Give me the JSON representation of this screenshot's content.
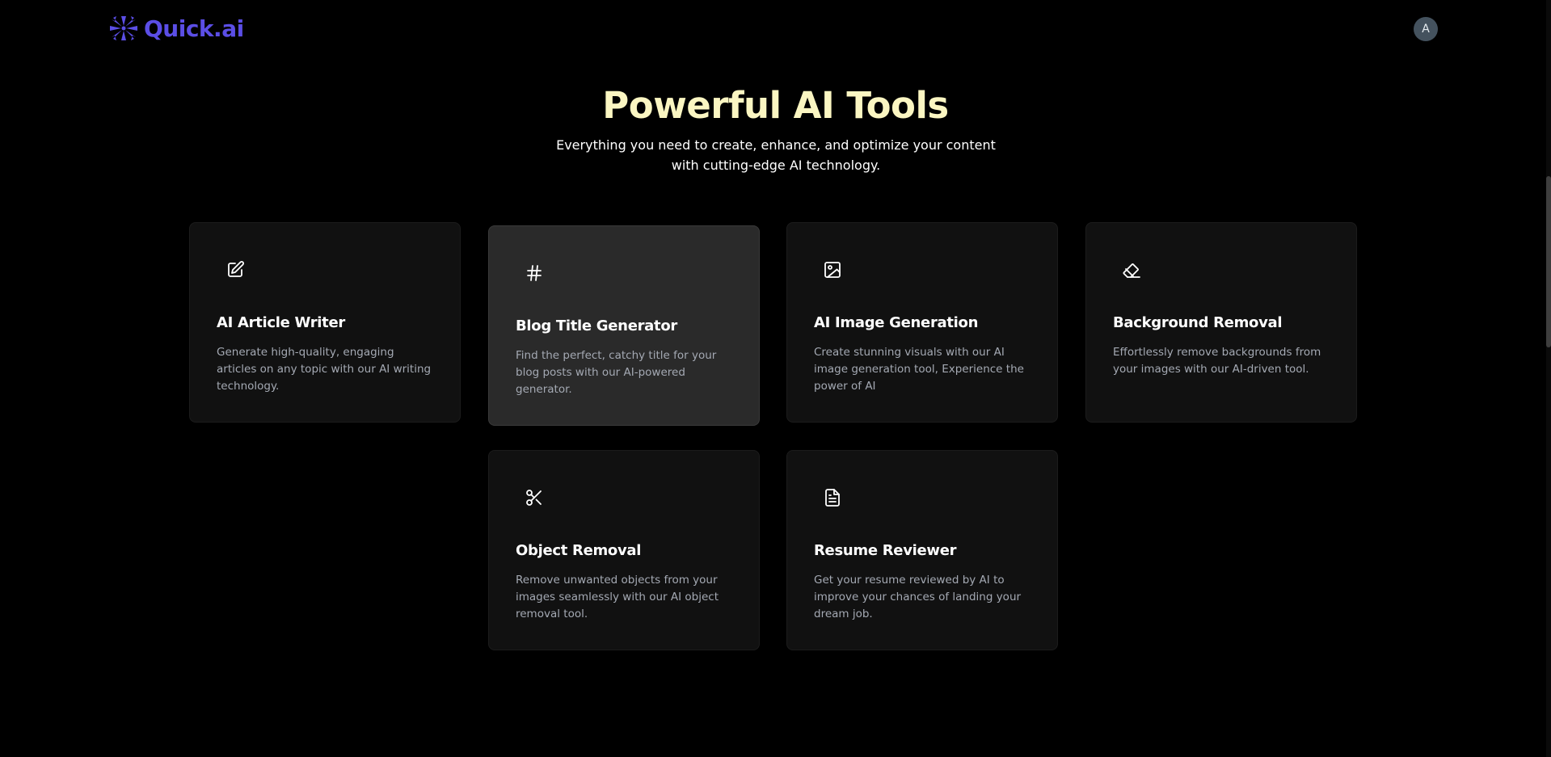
{
  "header": {
    "logo_text": "Quick.ai",
    "avatar_initial": "A"
  },
  "hero": {
    "title": "Powerful AI Tools",
    "subtitle": "Everything you need to create, enhance, and optimize your content with cutting-edge AI technology."
  },
  "tools": [
    {
      "title": "AI Article Writer",
      "description": "Generate high-quality, engaging articles on any topic with our AI writing technology.",
      "icon": "edit-square-icon"
    },
    {
      "title": "Blog Title Generator",
      "description": "Find the perfect, catchy title for your blog posts with our AI-powered generator.",
      "icon": "hash-icon"
    },
    {
      "title": "AI Image Generation",
      "description": "Create stunning visuals with our AI image generation tool, Experience the power of AI",
      "icon": "image-icon"
    },
    {
      "title": "Background Removal",
      "description": "Effortlessly remove backgrounds from your images with our AI-driven tool.",
      "icon": "eraser-icon"
    },
    {
      "title": "Object Removal",
      "description": "Remove unwanted objects from your images seamlessly with our AI object removal tool.",
      "icon": "scissors-icon"
    },
    {
      "title": "Resume Reviewer",
      "description": "Get your resume reviewed by AI to improve your chances of landing your dream job.",
      "icon": "file-text-icon"
    }
  ],
  "colors": {
    "brand": "#5b4ee6",
    "title": "#fbf6c2",
    "card_bg": "#111111",
    "card_active_bg": "#2a2a2a",
    "desc_text": "#a4a9b3"
  }
}
